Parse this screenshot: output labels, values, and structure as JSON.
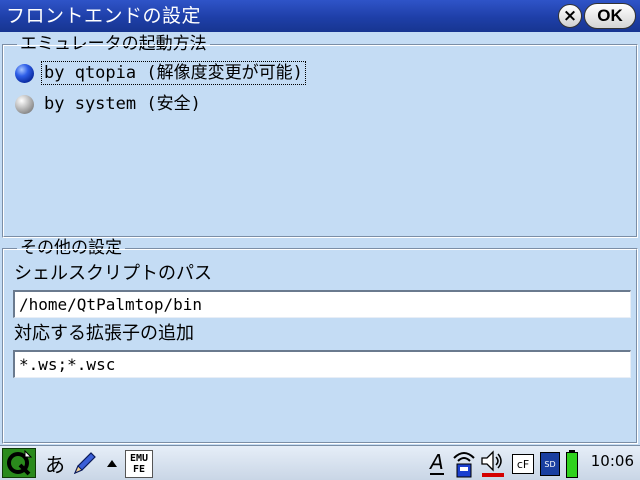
{
  "window": {
    "title": "フロントエンドの設定",
    "close_label": "×",
    "ok_label": "OK"
  },
  "emulator_group": {
    "legend": "エミュレータの起動方法",
    "options": [
      {
        "label": "by qtopia (解像度変更が可能)",
        "selected": true
      },
      {
        "label": "by system (安全)",
        "selected": false
      }
    ]
  },
  "other_group": {
    "legend": "その他の設定",
    "shell_path_label": "シェルスクリプトのパス",
    "shell_path_value": "/home/QtPalmtop/bin",
    "extensions_label": "対応する拡張子の追加",
    "extensions_value": "*.ws;*.wsc"
  },
  "taskbar": {
    "input_method_label": "あ",
    "emu_icon_line1": "EMU",
    "emu_icon_line2": "FE",
    "ime_label": "A",
    "cf_label": "cF",
    "sd_label": "SD",
    "clock": "10:06"
  },
  "colors": {
    "titlebar": "#1e3fa8",
    "background": "#c4dcf4",
    "start_button": "#2a8a1c",
    "battery": "#2fd21e"
  }
}
